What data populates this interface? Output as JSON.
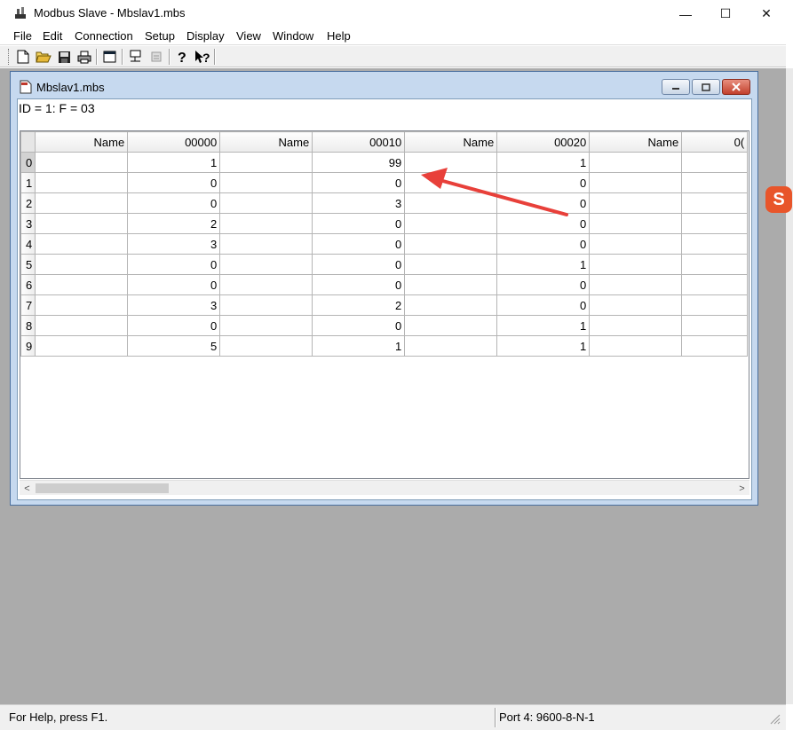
{
  "app": {
    "title": "Modbus Slave - Mbslav1.mbs",
    "window_buttons": {
      "minimize": "—",
      "maximize": "☐",
      "close": "✕"
    }
  },
  "menu": [
    "File",
    "Edit",
    "Connection",
    "Setup",
    "Display",
    "View",
    "Window",
    "Help"
  ],
  "toolbar": {
    "icons": [
      "new-icon",
      "open-icon",
      "save-icon",
      "print-icon",
      "window-icon",
      "connect-icon",
      "disconnect-icon",
      "help-icon",
      "context-help-icon"
    ]
  },
  "child_window": {
    "title": "Mbslav1.mbs",
    "id_line": "ID = 1: F = 03"
  },
  "grid": {
    "headers": [
      "Name",
      "00000",
      "Name",
      "00010",
      "Name",
      "00020",
      "Name",
      "0("
    ],
    "rows": [
      {
        "idx": "0",
        "c1": "1",
        "c2": "99",
        "c3": "1"
      },
      {
        "idx": "1",
        "c1": "0",
        "c2": "0",
        "c3": "0"
      },
      {
        "idx": "2",
        "c1": "0",
        "c2": "3",
        "c3": "0"
      },
      {
        "idx": "3",
        "c1": "2",
        "c2": "0",
        "c3": "0"
      },
      {
        "idx": "4",
        "c1": "3",
        "c2": "0",
        "c3": "0"
      },
      {
        "idx": "5",
        "c1": "0",
        "c2": "0",
        "c3": "1"
      },
      {
        "idx": "6",
        "c1": "0",
        "c2": "0",
        "c3": "0"
      },
      {
        "idx": "7",
        "c1": "3",
        "c2": "2",
        "c3": "0"
      },
      {
        "idx": "8",
        "c1": "0",
        "c2": "0",
        "c3": "1"
      },
      {
        "idx": "9",
        "c1": "5",
        "c2": "1",
        "c3": "1"
      }
    ]
  },
  "scrollbar": {
    "left": "<",
    "right": ">"
  },
  "status": {
    "help": "For Help, press F1.",
    "port": "Port 4: 9600-8-N-1"
  },
  "colors": {
    "mdi_background": "#ababab",
    "child_frame": "#c6d9ef",
    "annotation_arrow": "#e8403a"
  },
  "side_badge": "S"
}
